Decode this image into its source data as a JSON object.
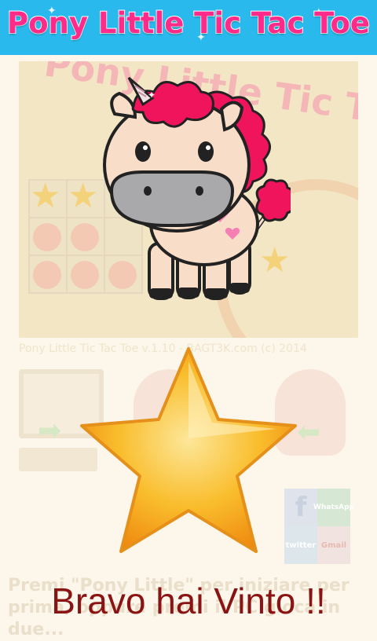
{
  "header": {
    "title": "Pony Little Tic Tac Toe"
  },
  "preview": {
    "title": "Pony Little Tic Tac Toe",
    "caption": "Pony Little Tic Tac Toe v.1.10 - BAGT3K.com (c) 2014"
  },
  "faded_instructions": "Premi \"Pony Little\" per iniziare per prima, oppure premi il PC gioca in due...",
  "social": {
    "facebook": "f",
    "whatsapp": "WhatsApp",
    "twitter": "twitter",
    "gmail": "Gmail"
  },
  "result": {
    "message": "Bravo hai Vinto !!"
  },
  "colors": {
    "header_bg": "#29b9ec",
    "title": "#ff2a8a",
    "mane": "#f0145c",
    "star": "#f8b21f",
    "message": "#8a1313"
  },
  "icons": [
    "unicorn-pony",
    "gold-star",
    "computer-icon",
    "facebook-icon",
    "whatsapp-icon",
    "twitter-icon",
    "gmail-icon"
  ]
}
